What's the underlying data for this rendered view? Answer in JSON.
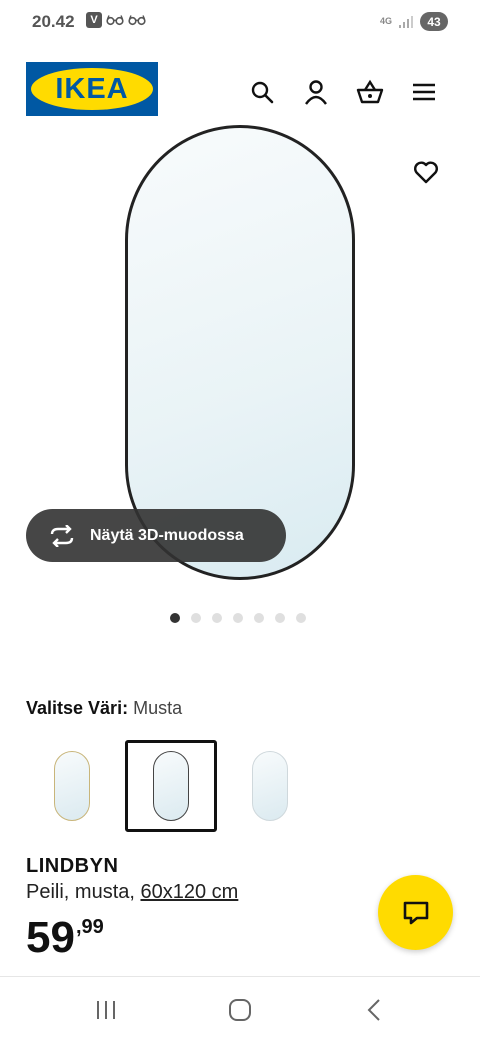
{
  "status_bar": {
    "time": "20.42",
    "app_badge": "V",
    "network": "4G",
    "battery": "43"
  },
  "header": {
    "logo_text": "IKEA",
    "icons": [
      "search-icon",
      "account-icon",
      "basket-icon",
      "menu-icon"
    ]
  },
  "gallery": {
    "view_3d_label": "Näytä 3D-muodossa",
    "image_count": 7,
    "active_index": 0
  },
  "color": {
    "label": "Valitse Väri:",
    "value": "Musta",
    "options": [
      {
        "frame": "#c8b57a"
      },
      {
        "frame": "#222222"
      },
      {
        "frame": "#cfd8dc"
      }
    ],
    "selected_index": 1
  },
  "product": {
    "name": "LINDBYN",
    "desc_prefix": "Peili, musta, ",
    "size": "60x120 cm",
    "price_int": "59",
    "price_dec": ",99"
  },
  "colors": {
    "ikea_blue": "#0058a3",
    "ikea_yellow": "#ffdb00"
  }
}
